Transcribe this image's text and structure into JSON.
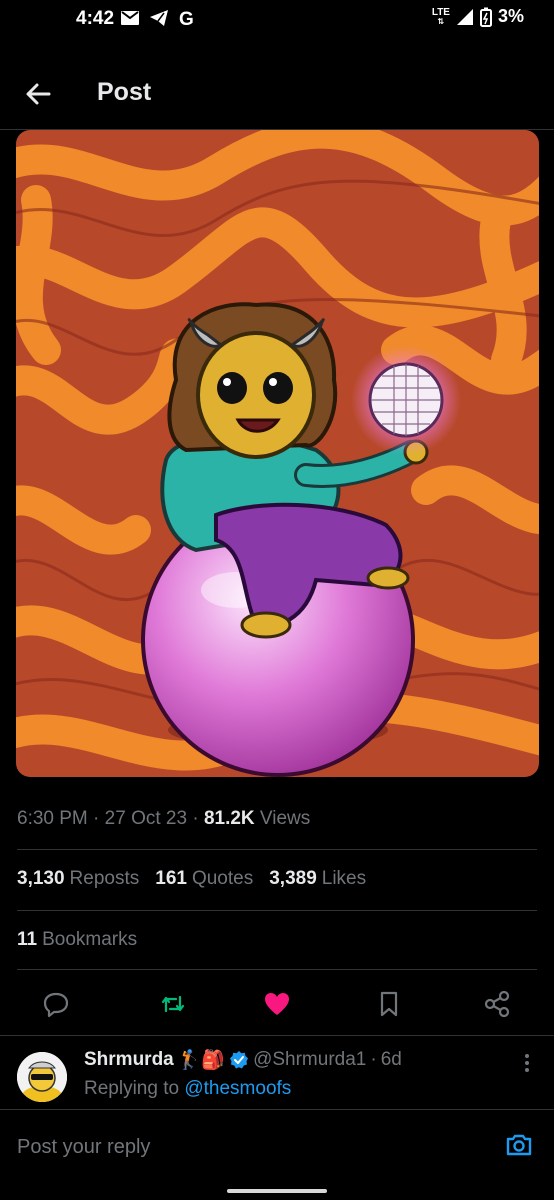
{
  "status_bar": {
    "time": "4:42",
    "network": "LTE",
    "battery": "3%"
  },
  "header": {
    "title": "Post"
  },
  "post": {
    "time": "6:30 PM",
    "date": "27 Oct 23",
    "views_count": "81.2K",
    "views_label": "Views",
    "reposts_count": "3,130",
    "reposts_label": "Reposts",
    "quotes_count": "161",
    "quotes_label": "Quotes",
    "likes_count": "3,389",
    "likes_label": "Likes",
    "bookmarks_count": "11",
    "bookmarks_label": "Bookmarks"
  },
  "reply": {
    "name": "Shrmurda",
    "name_emojis": "🏌🎒",
    "handle": "@Shrmurda1",
    "age": "6d",
    "replying_prefix": "Replying to",
    "replying_to": "@thesmoofs"
  },
  "composer": {
    "placeholder": "Post your reply"
  },
  "colors": {
    "background": "#000000",
    "text": "#e7e9ea",
    "muted": "#71767b",
    "link": "#1d9bf0",
    "like": "#f91880",
    "repost": "#00ba7c"
  }
}
